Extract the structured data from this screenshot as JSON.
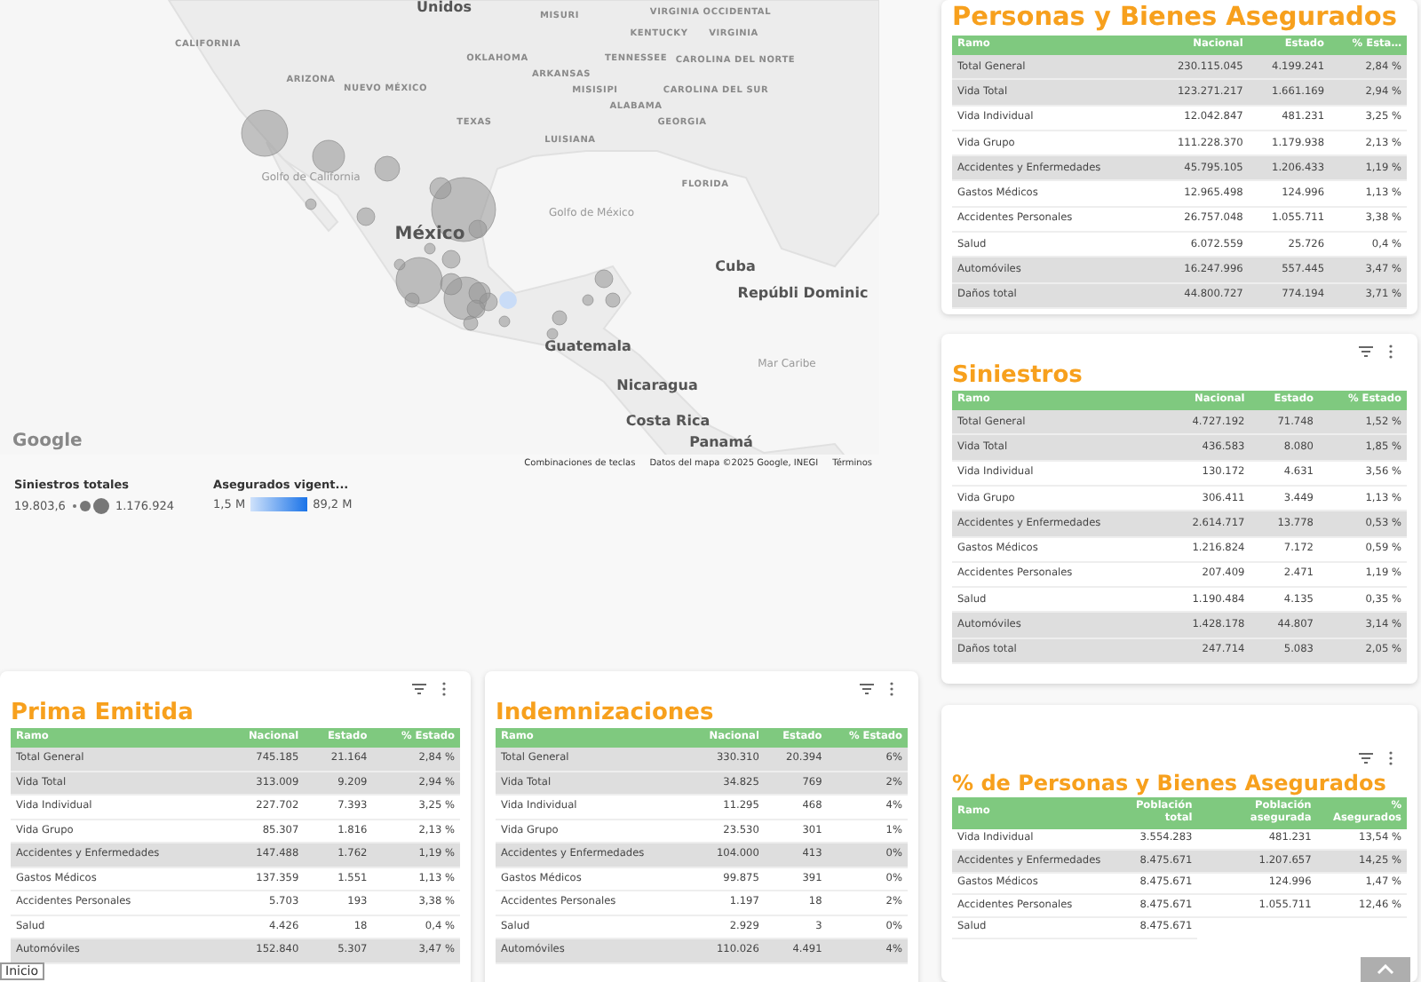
{
  "map": {
    "labels": [
      {
        "text": "Unidos",
        "kind": "country"
      },
      {
        "text": "MISURI",
        "kind": "state"
      },
      {
        "text": "VIRGINIA OCCIDENTAL",
        "kind": "state"
      },
      {
        "text": "KENTUCKY",
        "kind": "state"
      },
      {
        "text": "VIRGINIA",
        "kind": "state"
      },
      {
        "text": "CALIFORNIA",
        "kind": "state"
      },
      {
        "text": "OKLAHOMA",
        "kind": "state"
      },
      {
        "text": "TENNESSEE",
        "kind": "state"
      },
      {
        "text": "CAROLINA DEL NORTE",
        "kind": "state"
      },
      {
        "text": "ARKANSAS",
        "kind": "state"
      },
      {
        "text": "ARIZONA",
        "kind": "state"
      },
      {
        "text": "NUEVO MÉXICO",
        "kind": "state"
      },
      {
        "text": "MISISIPI",
        "kind": "state"
      },
      {
        "text": "CAROLINA DEL SUR",
        "kind": "state"
      },
      {
        "text": "ALABAMA",
        "kind": "state"
      },
      {
        "text": "TEXAS",
        "kind": "state"
      },
      {
        "text": "GEORGIA",
        "kind": "state"
      },
      {
        "text": "LUISIANA",
        "kind": "state"
      },
      {
        "text": "Golfo de California",
        "kind": "water"
      },
      {
        "text": "FLORIDA",
        "kind": "state"
      },
      {
        "text": "Golfo de México",
        "kind": "water"
      },
      {
        "text": "México",
        "kind": "capital"
      },
      {
        "text": "Cuba",
        "kind": "country"
      },
      {
        "text": "Repúbli Dominic",
        "kind": "country"
      },
      {
        "text": "Guatemala",
        "kind": "country"
      },
      {
        "text": "Mar Caribe",
        "kind": "water"
      },
      {
        "text": "Nicaragua",
        "kind": "country"
      },
      {
        "text": "Costa Rica",
        "kind": "country"
      },
      {
        "text": "Panamá",
        "kind": "country"
      }
    ],
    "logo": "Google",
    "footer_links": [
      "Combinaciones de teclas",
      "Datos del mapa ©2025 Google, INEGI",
      "Términos"
    ],
    "legend_size": {
      "title": "Siniestros totales",
      "min": "19.803,6",
      "max": "1.176.924"
    },
    "legend_color": {
      "title": "Asegurados vigent...",
      "min": "1,5 M",
      "max": "89,2 M"
    }
  },
  "tables": [
    {
      "title": "Personas y Bienes Asegurados",
      "columns": [
        "Ramo",
        "Nacional",
        "Estado",
        "% Esta…"
      ],
      "rows": [
        {
          "cells": [
            "Total General",
            "230.115.045",
            "4.199.241",
            "2,84 %"
          ],
          "highlighted": true
        },
        {
          "cells": [
            "Vida Total",
            "123.271.217",
            "1.661.169",
            "2,94 %"
          ],
          "highlighted": true
        },
        {
          "cells": [
            "Vida Individual",
            "12.042.847",
            "481.231",
            "3,25 %"
          ],
          "highlighted": false
        },
        {
          "cells": [
            "Vida Grupo",
            "111.228.370",
            "1.179.938",
            "2,13 %"
          ],
          "highlighted": false
        },
        {
          "cells": [
            "Accidentes y Enfermedades",
            "45.795.105",
            "1.206.433",
            "1,19 %"
          ],
          "highlighted": true
        },
        {
          "cells": [
            "Gastos Médicos",
            "12.965.498",
            "124.996",
            "1,13 %"
          ],
          "highlighted": false
        },
        {
          "cells": [
            "Accidentes Personales",
            "26.757.048",
            "1.055.711",
            "3,38 %"
          ],
          "highlighted": false
        },
        {
          "cells": [
            "Salud",
            "6.072.559",
            "25.726",
            "0,4 %"
          ],
          "highlighted": false
        },
        {
          "cells": [
            "Automóviles",
            "16.247.996",
            "557.445",
            "3,47 %"
          ],
          "highlighted": true
        },
        {
          "cells": [
            "Daños total",
            "44.800.727",
            "774.194",
            "3,71 %"
          ],
          "highlighted": true
        }
      ]
    },
    {
      "title": "Siniestros",
      "columns": [
        "Ramo",
        "Nacional",
        "Estado",
        "% Estado"
      ],
      "rows": [
        {
          "cells": [
            "Total General",
            "4.727.192",
            "71.748",
            "1,52 %"
          ],
          "highlighted": true
        },
        {
          "cells": [
            "Vida Total",
            "436.583",
            "8.080",
            "1,85 %"
          ],
          "highlighted": true
        },
        {
          "cells": [
            "Vida Individual",
            "130.172",
            "4.631",
            "3,56 %"
          ],
          "highlighted": false
        },
        {
          "cells": [
            "Vida Grupo",
            "306.411",
            "3.449",
            "1,13 %"
          ],
          "highlighted": false
        },
        {
          "cells": [
            "Accidentes y Enfermedades",
            "2.614.717",
            "13.778",
            "0,53 %"
          ],
          "highlighted": true
        },
        {
          "cells": [
            "Gastos Médicos",
            "1.216.824",
            "7.172",
            "0,59 %"
          ],
          "highlighted": false
        },
        {
          "cells": [
            "Accidentes Personales",
            "207.409",
            "2.471",
            "1,19 %"
          ],
          "highlighted": false
        },
        {
          "cells": [
            "Salud",
            "1.190.484",
            "4.135",
            "0,35 %"
          ],
          "highlighted": false
        },
        {
          "cells": [
            "Automóviles",
            "1.428.178",
            "44.807",
            "3,14 %"
          ],
          "highlighted": true
        },
        {
          "cells": [
            "Daños total",
            "247.714",
            "5.083",
            "2,05 %"
          ],
          "highlighted": true
        }
      ]
    },
    {
      "title": "Prima Emitida",
      "columns": [
        "Ramo",
        "Nacional",
        "Estado",
        "% Estado"
      ],
      "rows": [
        {
          "cells": [
            "Total General",
            "745.185",
            "21.164",
            "2,84 %"
          ],
          "highlighted": true
        },
        {
          "cells": [
            "Vida Total",
            "313.009",
            "9.209",
            "2,94 %"
          ],
          "highlighted": true
        },
        {
          "cells": [
            "Vida Individual",
            "227.702",
            "7.393",
            "3,25 %"
          ],
          "highlighted": false
        },
        {
          "cells": [
            "Vida Grupo",
            "85.307",
            "1.816",
            "2,13 %"
          ],
          "highlighted": false
        },
        {
          "cells": [
            "Accidentes y Enfermedades",
            "147.488",
            "1.762",
            "1,19 %"
          ],
          "highlighted": true
        },
        {
          "cells": [
            "Gastos Médicos",
            "137.359",
            "1.551",
            "1,13 %"
          ],
          "highlighted": false
        },
        {
          "cells": [
            "Accidentes Personales",
            "5.703",
            "193",
            "3,38 %"
          ],
          "highlighted": false
        },
        {
          "cells": [
            "Salud",
            "4.426",
            "18",
            "0,4 %"
          ],
          "highlighted": false
        },
        {
          "cells": [
            "Automóviles",
            "152.840",
            "5.307",
            "3,47 %"
          ],
          "highlighted": true
        }
      ]
    },
    {
      "title": "Indemnizaciones",
      "columns": [
        "Ramo",
        "Nacional",
        "Estado",
        "% Estado"
      ],
      "rows": [
        {
          "cells": [
            "Total General",
            "330.310",
            "20.394",
            "6%"
          ],
          "highlighted": true
        },
        {
          "cells": [
            "Vida Total",
            "34.825",
            "769",
            "2%"
          ],
          "highlighted": true
        },
        {
          "cells": [
            "Vida Individual",
            "11.295",
            "468",
            "4%"
          ],
          "highlighted": false
        },
        {
          "cells": [
            "Vida Grupo",
            "23.530",
            "301",
            "1%"
          ],
          "highlighted": false
        },
        {
          "cells": [
            "Accidentes y Enfermedades",
            "104.000",
            "413",
            "0%"
          ],
          "highlighted": true
        },
        {
          "cells": [
            "Gastos Médicos",
            "99.875",
            "391",
            "0%"
          ],
          "highlighted": false
        },
        {
          "cells": [
            "Accidentes Personales",
            "1.197",
            "18",
            "2%"
          ],
          "highlighted": false
        },
        {
          "cells": [
            "Salud",
            "2.929",
            "3",
            "0%"
          ],
          "highlighted": false
        },
        {
          "cells": [
            "Automóviles",
            "110.026",
            "4.491",
            "4%"
          ],
          "highlighted": true
        }
      ]
    },
    {
      "title": "% de Personas y Bienes Asegurados",
      "columns": [
        "Ramo",
        "Población total",
        "Población asegurada",
        "% Asegurados"
      ],
      "rows": [
        {
          "cells": [
            "Vida Individual",
            "3.554.283",
            "481.231",
            "13,54 %"
          ],
          "highlighted": false
        },
        {
          "cells": [
            "Accidentes y Enfermedades",
            "8.475.671",
            "1.207.657",
            "14,25 %"
          ],
          "highlighted": true
        },
        {
          "cells": [
            "Gastos Médicos",
            "8.475.671",
            "124.996",
            "1,47 %"
          ],
          "highlighted": false
        },
        {
          "cells": [
            "Accidentes Personales",
            "8.475.671",
            "1.055.711",
            "12,46 %"
          ],
          "highlighted": false
        },
        {
          "cells": [
            "Salud",
            "8.475.671"
          ],
          "highlighted": false
        }
      ]
    }
  ],
  "tooltip": "Inicio"
}
